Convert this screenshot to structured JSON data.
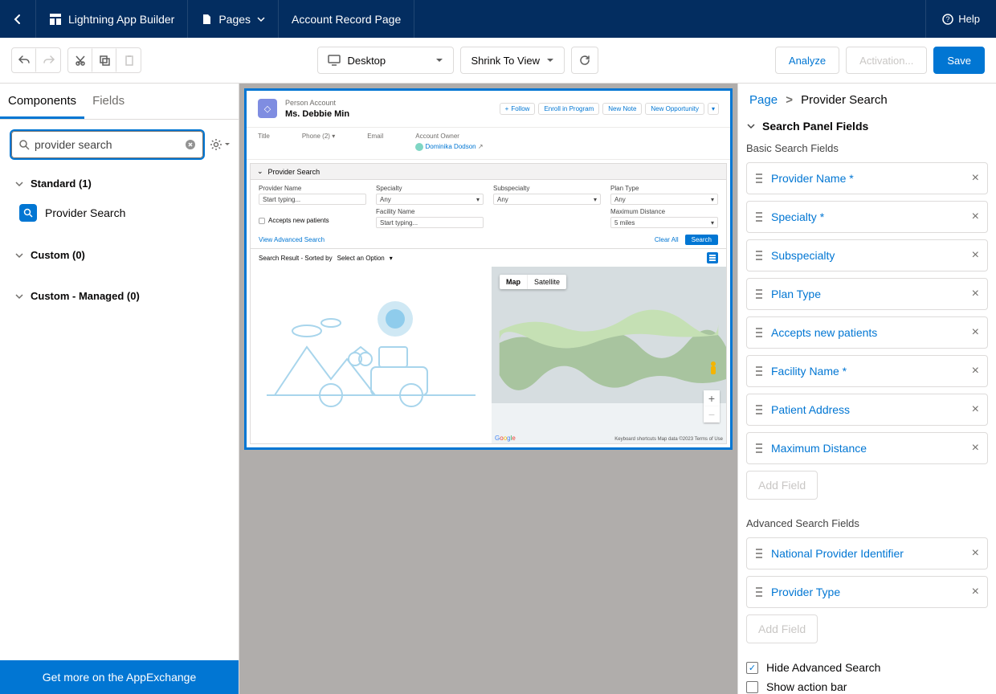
{
  "topbar": {
    "app_title": "Lightning App Builder",
    "pages_label": "Pages",
    "page_name": "Account Record Page",
    "help": "Help"
  },
  "toolbar": {
    "device_label": "Desktop",
    "view_label": "Shrink To View",
    "analyze": "Analyze",
    "activation": "Activation...",
    "save": "Save"
  },
  "left": {
    "tabs": {
      "components": "Components",
      "fields": "Fields"
    },
    "search_value": "provider search",
    "categories": {
      "standard_label": "Standard (1)",
      "custom_label": "Custom (0)",
      "managed_label": "Custom - Managed (0)"
    },
    "component_name": "Provider Search",
    "appexchange": "Get more on the AppExchange"
  },
  "preview": {
    "account_type": "Person Account",
    "account_name": "Ms. Debbie Min",
    "actions": {
      "follow": "Follow",
      "enroll": "Enroll in Program",
      "new_note": "New Note",
      "new_opp": "New Opportunity"
    },
    "fields": {
      "title": "Title",
      "phone": "Phone (2)",
      "email": "Email",
      "owner": "Account Owner",
      "owner_val": "Dominika Dodson"
    },
    "ps": {
      "header": "Provider Search",
      "provider_name": "Provider Name",
      "provider_name_ph": "Start typing...",
      "specialty": "Specialty",
      "any": "Any",
      "subspecialty": "Subspecialty",
      "plan_type": "Plan Type",
      "accepts": "Accepts new patients",
      "facility": "Facility Name",
      "facility_ph": "Start typing...",
      "maxdist": "Maximum Distance",
      "maxdist_val": "5 miles",
      "view_adv": "View Advanced Search",
      "clear": "Clear All",
      "search": "Search",
      "results": "Search Result - Sorted by",
      "sort_ph": "Select an Option",
      "map": "Map",
      "satellite": "Satellite",
      "map_footer": "Keyboard shortcuts   Map data ©2023   Terms of Use"
    }
  },
  "right": {
    "page_link": "Page",
    "crumb": "Provider Search",
    "section": "Search Panel Fields",
    "basic_label": "Basic Search Fields",
    "basic_fields": [
      "Provider Name *",
      "Specialty *",
      "Subspecialty",
      "Plan Type",
      "Accepts new patients",
      "Facility Name *",
      "Patient Address",
      "Maximum Distance"
    ],
    "add_field": "Add Field",
    "adv_label": "Advanced Search Fields",
    "adv_fields": [
      "National Provider Identifier",
      "Provider Type"
    ],
    "hide_adv": "Hide Advanced Search",
    "show_action": "Show action bar"
  }
}
